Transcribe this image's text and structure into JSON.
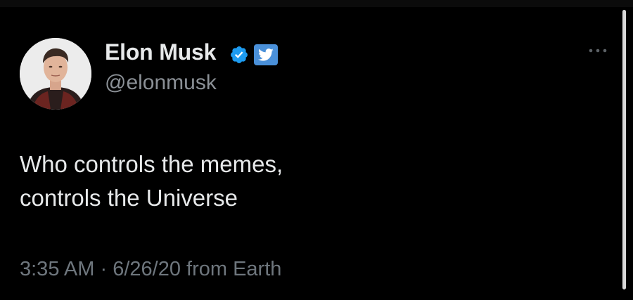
{
  "author": {
    "name": "Elon Musk",
    "handle": "@elonmusk"
  },
  "icons": {
    "verified": "verified-badge-icon",
    "twitter": "twitter-logo-icon",
    "more": "more-options-icon"
  },
  "tweet": {
    "text_lines": [
      "Who controls the memes,",
      "controls the Universe"
    ]
  },
  "meta": {
    "time": "3:35 AM",
    "separator": "·",
    "date": "6/26/20",
    "source": "from Earth"
  },
  "colors": {
    "background": "#000000",
    "text": "#e7e9ea",
    "secondary": "#8b9096",
    "verified_blue": "#1d9bf0",
    "twitter_box": "#4a90d9"
  }
}
